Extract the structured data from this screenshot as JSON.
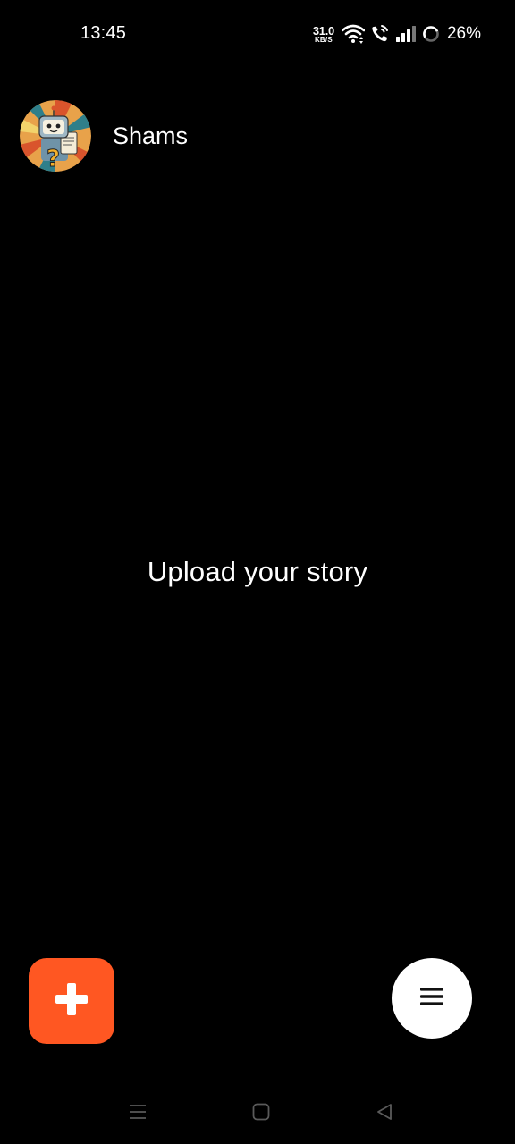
{
  "status_bar": {
    "time": "13:45",
    "net_speed_value": "31.0",
    "net_speed_unit": "KB/S",
    "battery_percent": "26%",
    "icons": [
      "wifi-icon",
      "volte-call-icon",
      "signal-icon",
      "battery-ring-icon"
    ]
  },
  "header": {
    "name": "Shams",
    "avatar_icon": "robot-avatar"
  },
  "main": {
    "empty_message": "Upload your story"
  },
  "fab": {
    "add_icon": "plus-icon",
    "menu_icon": "hamburger-menu-icon"
  },
  "nav_bar": {
    "icons": [
      "recents-icon",
      "home-icon",
      "back-icon"
    ]
  },
  "colors": {
    "background": "#000000",
    "accent": "#ff5722",
    "text": "#ffffff",
    "menu_fab": "#ffffff",
    "nav_icons": "#5a5a5a"
  }
}
